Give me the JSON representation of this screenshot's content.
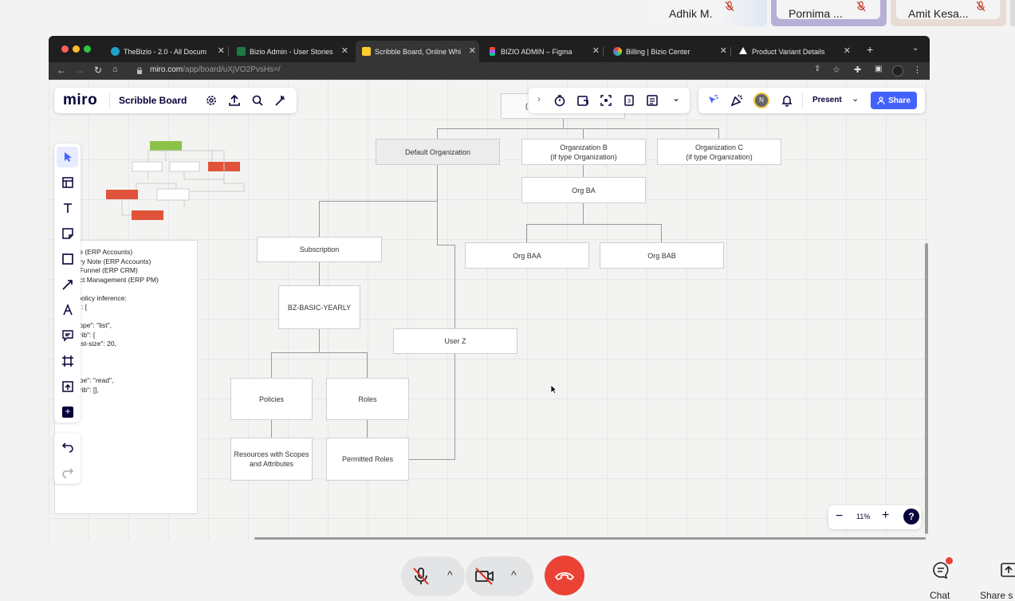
{
  "meeting": {
    "participants": [
      {
        "name": "Adhik M."
      },
      {
        "name": "Pornima ..."
      },
      {
        "name": "Amit Kesa..."
      }
    ],
    "controls": {
      "chat_label": "Chat",
      "share_label": "Share s"
    }
  },
  "browser": {
    "tabs": [
      {
        "title": "TheBizio - 2.0 - All Docum"
      },
      {
        "title": "Bizio Admin - User Stories"
      },
      {
        "title": "Scribble Board, Online Whi"
      },
      {
        "title": "BIZIO ADMIN – Figma"
      },
      {
        "title": "Billing | Bizio Center"
      },
      {
        "title": "Product Variant Details"
      }
    ],
    "url_host": "miro.com",
    "url_path": "/app/board/uXjVO2PvsHs=/"
  },
  "miro": {
    "logo": "miro",
    "board_name": "Scribble Board",
    "present_label": "Present",
    "share_label": "Share",
    "avatar_initial": "N",
    "zoom": "11%",
    "help": "?",
    "notes_lines": [
      "ce (ERP Accounts)",
      "ery Note (ERP Accounts)",
      "; Funnel (ERP CRM)",
      "ect Management (ERP PM)",
      "",
      " policy inference:",
      "e : [",
      "",
      "cope\": \"list\",",
      "ttrib\": [",
      "\"list-size\": 20,",
      "",
      "",
      "",
      "ope\": \"read\",",
      "ttrib\": [],"
    ],
    "nodes": {
      "top_partial": "(",
      "default_org": "Default Organization",
      "org_b": "Organization B\n(if type Organization)",
      "org_c": "Organization C\n(if type Organization)",
      "org_ba": "Org BA",
      "org_baa": "Org BAA",
      "org_bab": "Org BAB",
      "subscription": "Subscription",
      "plan": "BZ-BASIC-YEARLY",
      "user_z": "User Z",
      "policies": "Policies",
      "roles": "Roles",
      "resources": "Resources with Scopes\nand Attributes",
      "permitted_roles": "Permitted Roles"
    }
  },
  "colors": {
    "miro_blue": "#4262ff",
    "hangup_red": "#ea4335",
    "mini_green": "#8bc34a",
    "mini_red": "#e0533a"
  }
}
